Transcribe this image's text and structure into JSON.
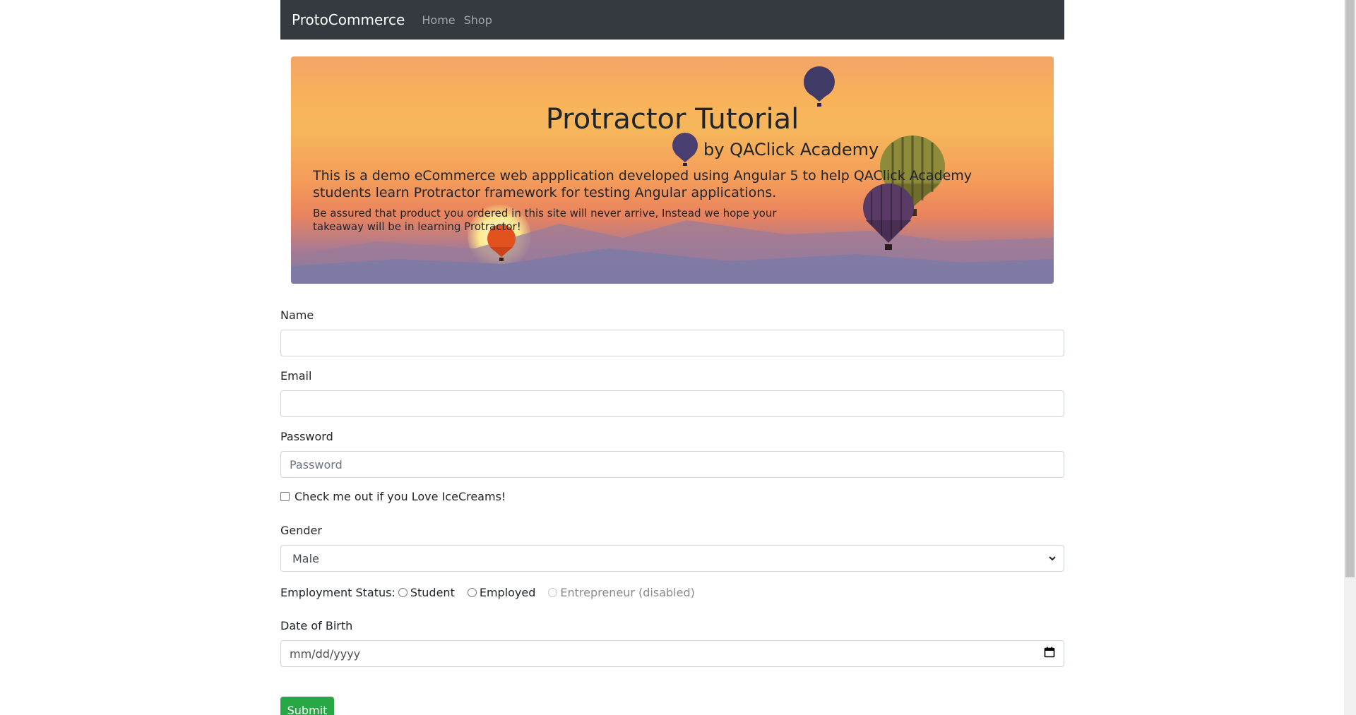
{
  "navbar": {
    "brand": "ProtoCommerce",
    "links": [
      "Home",
      "Shop"
    ]
  },
  "jumbotron": {
    "title": "Protractor Tutorial",
    "subtitle": "by QAClick Academy",
    "lead": "This is a demo eCommerce web appplication developed using Angular 5 to help QAClick Academy students learn Protractor framework for testing Angular applications.",
    "note": "Be assured that product you ordered in this site will never arrive, Instead we hope your takeaway will be in learning Protractor!"
  },
  "form": {
    "name": {
      "label": "Name",
      "value": "",
      "placeholder": ""
    },
    "email": {
      "label": "Email",
      "value": "",
      "placeholder": ""
    },
    "password": {
      "label": "Password",
      "value": "",
      "placeholder": "Password"
    },
    "checkbox": {
      "label": "Check me out if you Love IceCreams!",
      "checked": false
    },
    "gender": {
      "label": "Gender",
      "selected": "Male"
    },
    "employment": {
      "label": "Employment Status:",
      "options": [
        {
          "label": "Student",
          "disabled": false
        },
        {
          "label": "Employed",
          "disabled": false
        },
        {
          "label": "Entrepreneur (disabled)",
          "disabled": true
        }
      ]
    },
    "dob": {
      "label": "Date of Birth",
      "placeholder": "mm/dd/yyyy"
    },
    "submit_label": "Submit"
  },
  "icons": {
    "select_arrow": "chevron-down-icon",
    "calendar": "calendar-icon"
  },
  "colors": {
    "navbar_bg": "#343a40",
    "submit_bg": "#28a745",
    "border": "#ced4da"
  }
}
